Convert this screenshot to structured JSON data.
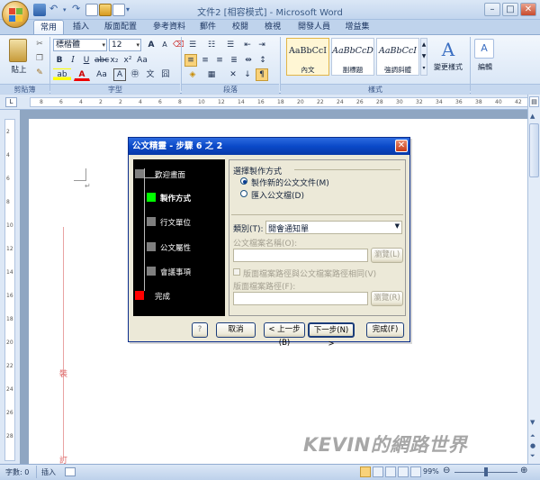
{
  "window": {
    "title": "文件2 [相容模式] - Microsoft Word"
  },
  "tabs": [
    {
      "label": "常用",
      "active": true
    },
    {
      "label": "插入"
    },
    {
      "label": "版面配置"
    },
    {
      "label": "參考資料"
    },
    {
      "label": "郵件"
    },
    {
      "label": "校閱"
    },
    {
      "label": "檢視"
    },
    {
      "label": "開發人員"
    },
    {
      "label": "增益集"
    }
  ],
  "ribbon": {
    "clipboard": {
      "paste_label": "貼上",
      "group_label": "剪貼簿"
    },
    "font": {
      "font_name": "標楷體",
      "font_size": "12",
      "group_label": "字型"
    },
    "paragraph": {
      "group_label": "段落"
    },
    "styles": {
      "group_label": "樣式",
      "items": [
        {
          "sample": "AaBbCcI",
          "name": "內文"
        },
        {
          "sample": "AaBbCcD",
          "name": "副標題"
        },
        {
          "sample": "AaBbCcI",
          "name": "強調斜體"
        }
      ],
      "change_label": "變更樣式"
    },
    "editing": {
      "label": "編輯"
    }
  },
  "ruler": {
    "marks": [
      "8",
      "6",
      "4",
      "2",
      "2",
      "4",
      "6",
      "8",
      "10",
      "12",
      "14",
      "16",
      "18",
      "20",
      "22",
      "24",
      "26",
      "28",
      "30",
      "32",
      "34",
      "36",
      "38",
      "40",
      "42"
    ]
  },
  "vruler": {
    "marks": [
      "2",
      "4",
      "6",
      "8",
      "10",
      "12",
      "14",
      "16",
      "18",
      "20",
      "22",
      "24",
      "26",
      "28"
    ]
  },
  "document": {
    "margin_text_1": "裝",
    "margin_text_2": "訂"
  },
  "dialog": {
    "title": "公文精靈 - 步驟 6 之 2",
    "steps": [
      {
        "label": "歡迎畫面",
        "color": "#7f7f7f"
      },
      {
        "label": "製作方式",
        "color": "#00ff00",
        "current": true
      },
      {
        "label": "行文單位",
        "color": "#7f7f7f"
      },
      {
        "label": "公文屬性",
        "color": "#7f7f7f"
      },
      {
        "label": "會議事項",
        "color": "#7f7f7f"
      },
      {
        "label": "完成",
        "color": "#ff0000"
      }
    ],
    "section_title": "選擇製作方式",
    "option_new": "製作新的公文文件(M)",
    "option_import": "匯入公文檔(D)",
    "category_label": "類別(T):",
    "category_value": "開會通知單",
    "file_name_label": "公文檔案名稱(O):",
    "browse_label_1": "瀏覽(L)",
    "same_path_label": "版面檔案路徑與公文檔案路徑相同(V)",
    "layout_path_label": "版面檔案路徑(F):",
    "browse_label_2": "瀏覽(R)",
    "help_label": "?",
    "cancel_label": "取消",
    "back_label": "< 上一步(B)",
    "next_label": "下一步(N) >",
    "finish_label": "完成(F)"
  },
  "status": {
    "words": "字數: 0",
    "mode": "插入",
    "zoom": "99%"
  },
  "watermark": "KEVIN的網路世界"
}
